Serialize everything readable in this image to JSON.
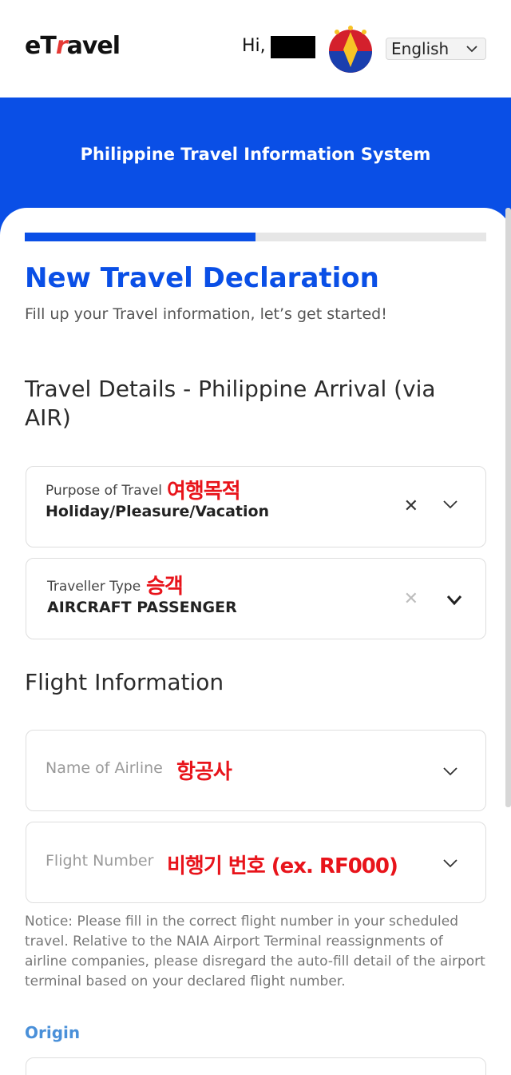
{
  "header": {
    "logo_prefix": "eT",
    "logo_accent": "r",
    "logo_suffix": "avel",
    "greeting": "Hi,",
    "language": "English"
  },
  "banner": {
    "title": "Philippine Travel Information System"
  },
  "progress": {
    "value": 0.5
  },
  "form": {
    "title": "New Travel Declaration",
    "subtitle": "Fill up your Travel information, let’s get started!",
    "section_travel": "Travel Details - Philippine Arrival (via AIR)",
    "purpose": {
      "label": "Purpose of Travel",
      "annotation": "여행목적",
      "value": "Holiday/Pleasure/Vacation"
    },
    "traveller": {
      "label": "Traveller Type",
      "annotation": "승객",
      "value": "AIRCRAFT PASSENGER"
    },
    "section_flight": "Flight Information",
    "airline": {
      "placeholder": "Name of Airline",
      "annotation": "항공사"
    },
    "flight_number": {
      "placeholder": "Flight Number",
      "annotation": "비행기 번호 (ex. RF000)"
    },
    "notice": "Notice: Please fill in the correct flight number in your scheduled travel. Relative to the NAIA Airport Terminal reassignments of airline companies, please disregard the auto-fill detail of the airport terminal based on your declared flight number.",
    "origin_label": "Origin"
  },
  "colors": {
    "brand_blue": "#0a4fe6",
    "annotation_red": "#e8141b",
    "origin_blue": "#4a90d9"
  },
  "icons": [
    "clear-icon",
    "chevron-down-icon",
    "philippine-seal-icon"
  ]
}
